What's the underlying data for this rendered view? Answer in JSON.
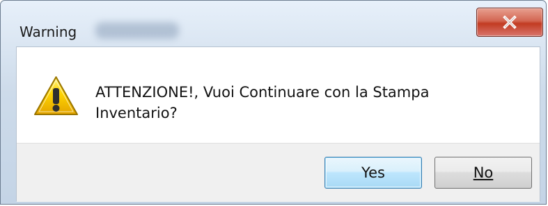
{
  "window": {
    "title": "Warning",
    "close_label": "X"
  },
  "message": {
    "icon": "warning-icon",
    "text": "ATTENZIONE!, Vuoi Continuare con la Stampa Inventario?"
  },
  "buttons": {
    "yes_label": "Yes",
    "no_label": "No"
  },
  "colors": {
    "title_bar": "#cddbea",
    "close_button": "#c23b22",
    "warning_yellow": "#f2c500",
    "default_button_border": "#3c7fb1"
  }
}
